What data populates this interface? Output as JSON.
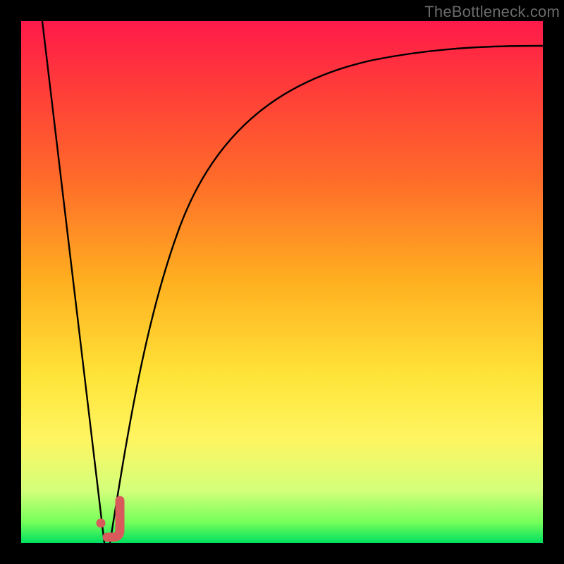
{
  "watermark": "TheBottleneck.com",
  "chart_data": {
    "type": "line",
    "title": "",
    "xlabel": "",
    "ylabel": "",
    "x_range": [
      0,
      100
    ],
    "y_range": [
      0,
      100
    ],
    "grid": false,
    "legend": false,
    "series": [
      {
        "name": "left-descent",
        "x": [
          4,
          16
        ],
        "y": [
          100,
          0
        ]
      },
      {
        "name": "right-ascent",
        "x": [
          17,
          20,
          25,
          30,
          40,
          55,
          75,
          100
        ],
        "y": [
          0,
          20,
          45,
          60,
          76,
          86,
          92,
          95
        ]
      }
    ],
    "marker_point": {
      "x": 15.5,
      "y": 3
    }
  },
  "colors": {
    "curve": "#000000",
    "marker": "#d85a5a",
    "marker_dot": "#d85a5a"
  }
}
